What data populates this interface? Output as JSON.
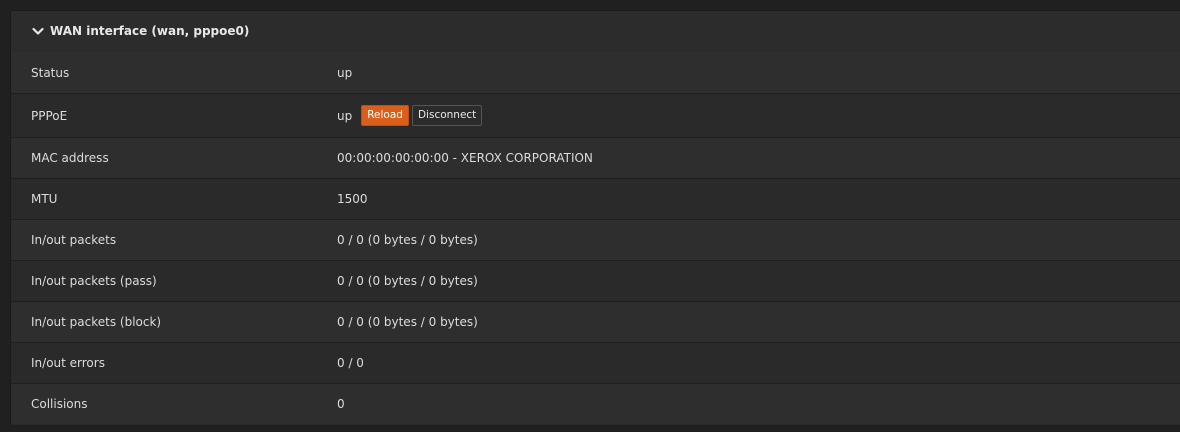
{
  "panel": {
    "title": "WAN interface (wan, pppoe0)",
    "toggle_icon": "chevron-down-icon"
  },
  "rows": [
    {
      "label": "Status",
      "value": "up"
    },
    {
      "label": "PPPoE",
      "value": "up",
      "buttons": {
        "reload": "Reload",
        "disconnect": "Disconnect"
      }
    },
    {
      "label": "MAC address",
      "value": "00:00:00:00:00:00 - XEROX CORPORATION"
    },
    {
      "label": "MTU",
      "value": "1500"
    },
    {
      "label": "In/out packets",
      "value": "0 / 0 (0 bytes / 0 bytes)"
    },
    {
      "label": "In/out packets (pass)",
      "value": "0 / 0 (0 bytes / 0 bytes)"
    },
    {
      "label": "In/out packets (block)",
      "value": "0 / 0 (0 bytes / 0 bytes)"
    },
    {
      "label": "In/out errors",
      "value": "0 / 0"
    },
    {
      "label": "Collisions",
      "value": "0"
    }
  ],
  "colors": {
    "accent": "#d95f1a",
    "background": "#202020",
    "panel": "#2a2a2a"
  }
}
